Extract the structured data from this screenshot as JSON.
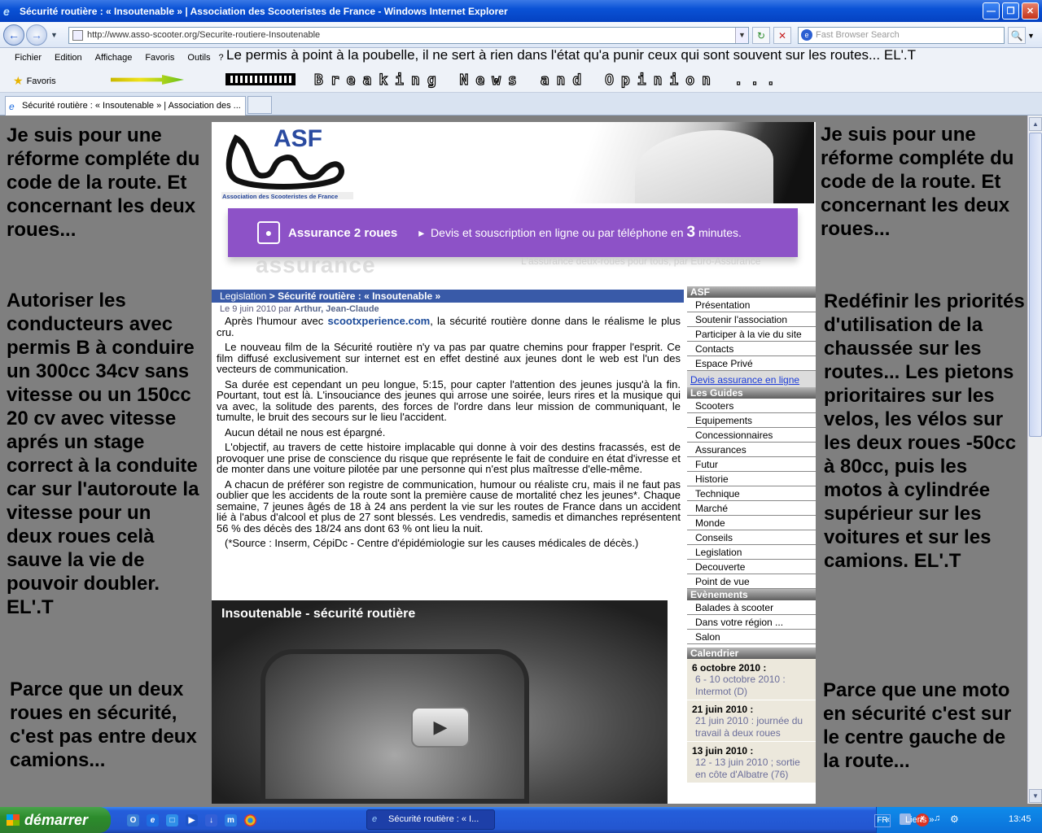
{
  "window": {
    "title": "Sécurité routière : « Insoutenable » | Association des Scooteristes de France - Windows Internet Explorer"
  },
  "nav": {
    "url": "http://www.asso-scooter.org/Securite-routiere-Insoutenable",
    "search_placeholder": "Fast Browser Search"
  },
  "menu": {
    "items": [
      "Fichier",
      "Edition",
      "Affichage",
      "Favoris",
      "Outils",
      "?"
    ],
    "marquee": "Le permis à point à la poubelle, il ne sert à rien dans l'état qu'a punir ceux qui sont souvent sur les routes... EL'.T"
  },
  "favbar": {
    "favoris": "Favoris",
    "breaking": "Breaking News and Opinion ..."
  },
  "tab": {
    "label": "Sécurité routière : « Insoutenable » | Association des ..."
  },
  "left": {
    "block1": "Je suis pour une réforme compléte du code de la route. Et concernant les deux roues...",
    "block2": "Autoriser les conducteurs avec permis B à conduire un 300cc 34cv sans vitesse ou un 150cc 20 cv avec vitesse aprés un stage correct à la conduite car sur l'autoroute la vitesse pour un deux roues celà sauve la vie de pouvoir doubler. EL'.T",
    "block3": "Parce que un deux roues en sécurité, c'est pas entre deux camions..."
  },
  "right": {
    "block1": "Je suis pour une réforme compléte du code de la route. Et concernant les deux roues...",
    "block2": "Redéfinir les priorités d'utilisation de la chaussée sur les routes... Les pietons prioritaires sur les velos, les vélos sur les deux roues -50cc à 80cc, puis les motos à cylindrée supérieur sur les voitures et sur les camions. EL'.T",
    "block3": "Parce que une moto en sécurité c'est sur le centre gauche de la route..."
  },
  "site": {
    "logo_text": "ASF",
    "logo_caption": "Association des Scooteristes de France",
    "promo_label": "Assurance 2 roues",
    "promo_text": "Devis et souscription en ligne ou par téléphone en",
    "promo_number": "3",
    "promo_unit": "minutes.",
    "ghost_logo": "assurance",
    "ghost_tagline": "L'assurance deux-roues pour tous, par Euro-Assurance"
  },
  "article": {
    "crumb_section": "Legislation",
    "crumb_sep": " > ",
    "crumb_title": "Sécurité routière : « Insoutenable »",
    "byline_prefix": "Le 9 juin 2010 par ",
    "byline_authors": "Arthur, Jean-Claude",
    "p1_a": "Après l'humour avec ",
    "p1_link": "scootxperience.com",
    "p1_b": ", la sécurité routière donne dans le réalisme le plus cru.",
    "p2": "Le nouveau film de la Sécurité routière n'y va pas par quatre chemins pour frapper l'esprit. Ce film diffusé exclusivement sur internet est en effet destiné aux jeunes dont le web est l'un des vecteurs de communication.",
    "p3": "Sa durée est cependant un peu longue, 5:15, pour capter l'attention des jeunes jusqu'à la fin. Pourtant, tout est là. L'insouciance des jeunes qui arrose une soirée, leurs rires et la musique qui va avec, la solitude des parents, des forces de l'ordre dans leur mission de communiquant, le tumulte, le bruit des secours sur le lieu l'accident.",
    "p4": "Aucun détail ne nous est épargné.",
    "p5": "L'objectif, au travers de cette histoire implacable qui donne à voir des destins fracassés, est de provoquer une prise de conscience du risque que représente le fait de conduire en état d'ivresse et de monter dans une voiture pilotée par une personne qui n'est plus maîtresse d'elle-même.",
    "p6": "A chacun de préférer son registre de communication, humour ou réaliste cru, mais il ne faut pas oublier que les accidents de la route sont la première cause de mortalité chez les jeunes*. Chaque semaine, 7 jeunes âgés de 18 à 24 ans perdent la vie sur les routes de France dans un accident lié à l'abus d'alcool et plus de 27 sont blessés. Les vendredis, samedis et dimanches représentent 56 % des décès des 18/24 ans dont 63 % ont lieu la nuit.",
    "p7": "(*Source : Inserm, CépiDc - Centre d'épidémiologie sur les causes médicales de décès.)",
    "video_title": "Insoutenable - sécurité routière"
  },
  "sidebar": {
    "asf_head": "ASF",
    "asf_items": [
      "Présentation",
      "Soutenir l'association",
      "Participer à la vie du site",
      "Contacts",
      "Espace Privé"
    ],
    "devis": "Devis assurance en ligne",
    "guides_head": "Les Guides",
    "guides_items": [
      "Scooters",
      "Equipements",
      "Concessionnaires",
      "Assurances",
      "Futur",
      "Historie",
      "Technique",
      "Marché",
      "Monde",
      "Conseils",
      "Legislation",
      "Decouverte",
      "Point de vue"
    ],
    "events_head": "Evènements",
    "events_items": [
      "Balades à scooter",
      "Dans votre région ...",
      "Salon"
    ],
    "cal_head": "Calendrier",
    "cal": [
      {
        "date": "6 octobre 2010 :",
        "event": "6 - 10 octobre 2010 : Intermot (D)"
      },
      {
        "date": "21 juin 2010 :",
        "event": "21 juin 2010 : journée du travail à deux roues"
      },
      {
        "date": "13 juin 2010 :",
        "event": "12 - 13 juin 2010 ; sortie en côte d'Albatre (76)"
      }
    ]
  },
  "taskbar": {
    "start": "démarrer",
    "item": "Sécurité routière : « I...",
    "lang": "FR",
    "liens": "Liens",
    "clock": "13:45"
  },
  "colors": {
    "ie_blue": "#0a52d6",
    "asf_purple": "#8d52c7",
    "crumb_blue": "#395aa8",
    "page_gray": "#7f7f7f",
    "start_green": "#2c8c2c"
  }
}
